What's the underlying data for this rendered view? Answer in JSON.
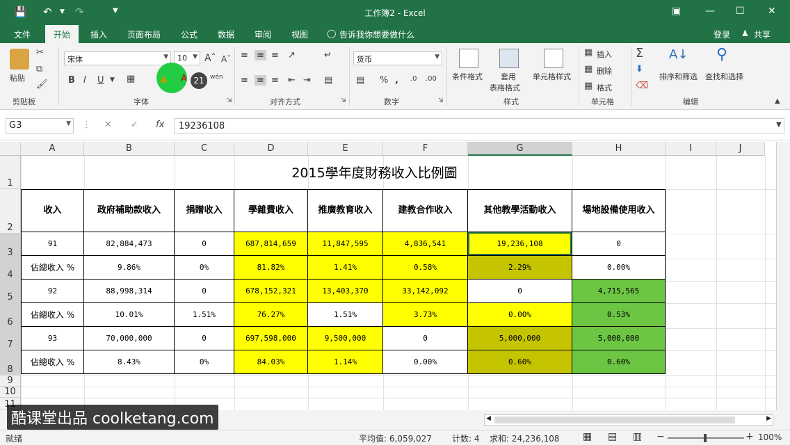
{
  "window": {
    "title": "工作簿2 - Excel"
  },
  "tabs": [
    "文件",
    "开始",
    "插入",
    "页面布局",
    "公式",
    "数据",
    "审阅",
    "视图"
  ],
  "tell_me": "告诉我你想要做什么",
  "account": {
    "login": "登录",
    "share": "共享"
  },
  "ribbon": {
    "clipboard": {
      "paste": "粘贴",
      "label": "剪贴板"
    },
    "font": {
      "name": "宋体",
      "size": "10",
      "label": "字体",
      "bold": "B",
      "italic": "I",
      "underline": "U",
      "badge": "21",
      "wen": "wén"
    },
    "align": {
      "label": "对齐方式"
    },
    "number": {
      "format": "货币",
      "label": "数字",
      "percent": "%"
    },
    "styles": {
      "cond": "条件格式",
      "table1": "套用",
      "table2": "表格格式",
      "cell": "单元格样式",
      "label": "样式"
    },
    "cells": {
      "insert": "插入",
      "delete": "删除",
      "format": "格式",
      "label": "单元格"
    },
    "edit": {
      "sort": "排序和筛选",
      "find": "查找和选择",
      "label": "编辑"
    }
  },
  "formula_bar": {
    "name_box": "G3",
    "value": "19236108",
    "fx": "fx"
  },
  "columns": [
    "A",
    "B",
    "C",
    "D",
    "E",
    "F",
    "G",
    "H",
    "I",
    "J"
  ],
  "rows": [
    "1",
    "2",
    "3",
    "4",
    "5",
    "6",
    "7",
    "8",
    "9",
    "10",
    "11"
  ],
  "sheet": {
    "title": "2015學年度財務收入比例圖",
    "headers": [
      "收入",
      "政府補助款收入",
      "捐贈收入",
      "學雜費收入",
      "推廣教育收入",
      "建教合作收入",
      "其他教學活動收入",
      "場地設備使用收入"
    ],
    "data_rows": [
      [
        "91",
        "82,884,473",
        "0",
        "687,814,659",
        "11,847,595",
        "4,836,541",
        "19,236,108",
        "0"
      ],
      [
        "佔總收入 %",
        "9.86%",
        "0%",
        "81.82%",
        "1.41%",
        "0.58%",
        "2.29%",
        "0.00%"
      ],
      [
        "92",
        "88,998,314",
        "0",
        "678,152,321",
        "13,403,370",
        "33,142,092",
        "0",
        "4,715,565"
      ],
      [
        "佔總收入 %",
        "10.01%",
        "1.51%",
        "76.27%",
        "1.51%",
        "3.73%",
        "0.00%",
        "0.53%"
      ],
      [
        "93",
        "70,000,000",
        "0",
        "697,598,000",
        "9,500,000",
        "0",
        "5,000,000",
        "5,000,000"
      ],
      [
        "佔總收入 %",
        "8.43%",
        "0%",
        "84.03%",
        "1.14%",
        "0.00%",
        "0.60%",
        "0.60%"
      ]
    ],
    "fills": [
      [
        "w",
        "w",
        "w",
        "y",
        "y",
        "y",
        "ys",
        "w"
      ],
      [
        "w",
        "w",
        "w",
        "y",
        "y",
        "y",
        "o",
        "w"
      ],
      [
        "w",
        "w",
        "w",
        "y",
        "y",
        "y",
        "w",
        "g"
      ],
      [
        "w",
        "w",
        "w",
        "y",
        "w",
        "y",
        "y",
        "g"
      ],
      [
        "w",
        "w",
        "w",
        "y",
        "y",
        "w",
        "o",
        "g"
      ],
      [
        "w",
        "w",
        "w",
        "y",
        "y",
        "w",
        "o",
        "g"
      ]
    ]
  },
  "watermark": "酷课堂出品 coolketang.com",
  "status": {
    "ready": "就绪",
    "avg": "平均值: 6,059,027",
    "count": "计数: 4",
    "sum": "求和: 24,236,108",
    "zoom": "100%"
  }
}
